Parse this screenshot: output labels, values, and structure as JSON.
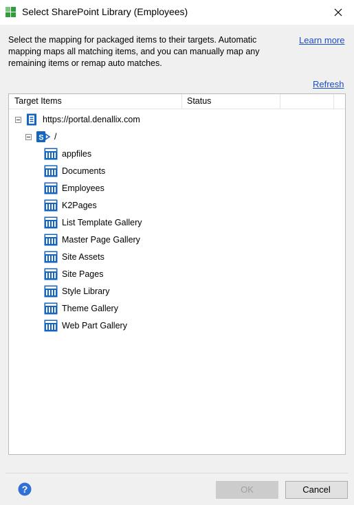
{
  "window": {
    "title": "Select SharePoint Library (Employees)"
  },
  "description": "Select the mapping for packaged items to their targets. Automatic mapping maps all matching items, and you can manually map any remaining items or remap auto matches.",
  "links": {
    "learn_more": "Learn more",
    "refresh": "Refresh"
  },
  "columns": {
    "target": "Target Items",
    "status": "Status"
  },
  "tree": {
    "site": "https://portal.denallix.com",
    "web": "/",
    "libraries": [
      "appfiles",
      "Documents",
      "Employees",
      "K2Pages",
      "List Template Gallery",
      "Master Page Gallery",
      "Site Assets",
      "Site Pages",
      "Style Library",
      "Theme Gallery",
      "Web Part Gallery"
    ]
  },
  "buttons": {
    "ok": "OK",
    "cancel": "Cancel"
  },
  "colors": {
    "accent": "#1565c0",
    "link": "#1a4ec0",
    "logo_green": "#2e9e3e"
  }
}
